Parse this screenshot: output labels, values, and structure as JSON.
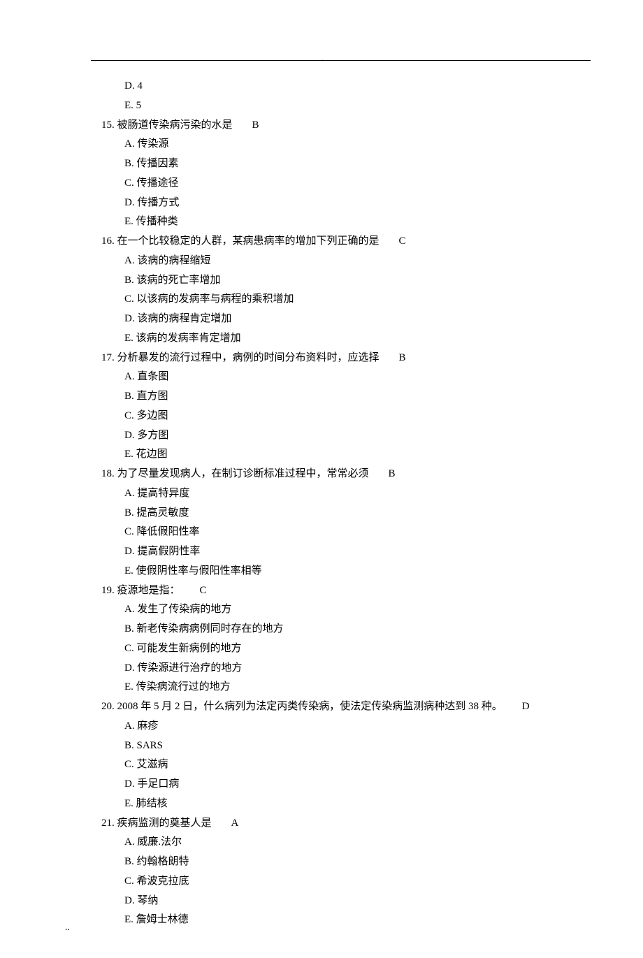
{
  "top_dot": ".",
  "footer_dot": "..",
  "pre_opts": [
    "D. 4",
    "E. 5"
  ],
  "questions": [
    {
      "num": "15.",
      "stem": "被肠道传染病污染的水是",
      "ans": "B",
      "opts": [
        "A. 传染源",
        "B. 传播因素",
        "C. 传播途径",
        "D. 传播方式",
        "E. 传播种类"
      ]
    },
    {
      "num": "16.",
      "stem": "在一个比较稳定的人群，某病患病率的增加下列正确的是",
      "ans": "C",
      "opts": [
        "A.     该病的病程缩短",
        "B.     该病的死亡率增加",
        "C.     以该病的发病率与病程的乘积增加",
        "D.     该病的病程肯定增加",
        "E.     该病的发病率肯定增加"
      ]
    },
    {
      "num": "17.",
      "stem": "分析暴发的流行过程中，病例的时间分布资料时，应选择",
      "ans": "B",
      "opts": [
        "A. 直条图",
        "B. 直方图",
        "C. 多边图",
        "D. 多方图",
        "E. 花边图"
      ]
    },
    {
      "num": "18.",
      "stem": "为了尽量发现病人，在制订诊断标准过程中，常常必须",
      "ans": "B",
      "opts": [
        "A. 提高特异度",
        "B. 提高灵敏度",
        "C. 降低假阳性率",
        "D. 提高假阴性率",
        "E. 使假阴性率与假阳性率相等"
      ]
    },
    {
      "num": "19.",
      "stem": "疫源地是指：",
      "ans": "C",
      "opts": [
        "A. 发生了传染病的地方",
        "B. 新老传染病病例同时存在的地方",
        "C. 可能发生新病例的地方",
        "D. 传染源进行治疗的地方",
        "E. 传染病流行过的地方"
      ]
    },
    {
      "num": "20.",
      "stem": "2008 年 5 月 2 日，什么病列为法定丙类传染病，使法定传染病监测病种达到 38 种。",
      "ans": "D",
      "opts": [
        "A. 麻疹",
        "B. SARS",
        "C. 艾滋病",
        "D. 手足口病",
        "E. 肺结核"
      ]
    },
    {
      "num": "21.",
      "stem": "疾病监测的奠基人是",
      "ans": "A",
      "opts": [
        "A. 威廉.法尔",
        "B. 约翰格朗特",
        "C. 希波克拉底",
        "D. 琴纳",
        "E. 詹姆士林德"
      ]
    }
  ]
}
